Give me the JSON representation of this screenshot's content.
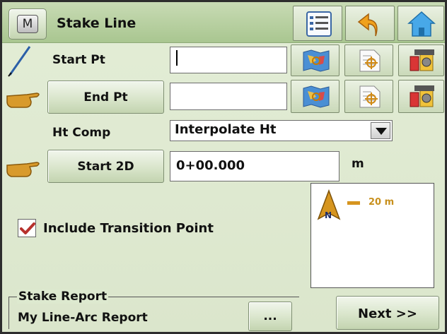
{
  "window": {
    "title": "Stake Line",
    "menu_glyph": "M"
  },
  "toolbar": {
    "icons": [
      "list-icon",
      "undo-arrow-icon",
      "home-icon"
    ]
  },
  "start_pt": {
    "label": "Start Pt",
    "value": "",
    "icon": "pencil-line-icon"
  },
  "end_pt": {
    "label": "End Pt",
    "value": "",
    "icon": "pointing-hand-icon"
  },
  "ht_comp": {
    "label": "Ht Comp",
    "selected": "Interpolate Ht"
  },
  "start_2d": {
    "label": "Start 2D",
    "value": "0+00.000",
    "unit": "m",
    "icon": "pointing-hand-icon"
  },
  "map": {
    "scale_label": "20 m",
    "north_label": "N"
  },
  "transition": {
    "label": "Include Transition Point",
    "checked": true
  },
  "report": {
    "group_title": "Stake Report",
    "name": "My Line-Arc Report",
    "browse_label": "..."
  },
  "next_button": {
    "label": "Next >>"
  },
  "colors": {
    "accent_green": "#b7cf9f",
    "map_orange": "#d6951f",
    "check_red": "#b7312c"
  }
}
